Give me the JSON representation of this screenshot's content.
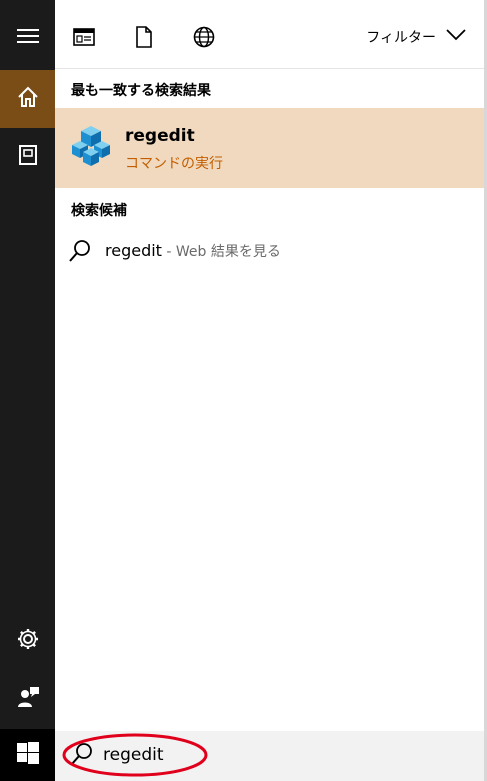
{
  "rail": {
    "items": [
      {
        "icon": "hamburger-menu-icon"
      },
      {
        "icon": "home-icon",
        "active": true
      },
      {
        "icon": "notebook-icon"
      },
      {
        "icon": "gear-icon"
      },
      {
        "icon": "feedback-person-icon"
      },
      {
        "icon": "windows-logo-icon"
      }
    ],
    "accent_color": "#7a4d17"
  },
  "topbar": {
    "icons": [
      "apps-view-icon",
      "document-icon",
      "globe-icon"
    ],
    "filter_label": "フィルター"
  },
  "best_match": {
    "section_label": "最も一致する検索結果",
    "title": "regedit",
    "subtitle": "コマンドの実行",
    "icon": "regedit-cubes-icon",
    "highlight_color": "#f0d9be",
    "subtitle_color": "#c25e00"
  },
  "suggestions": {
    "section_label": "検索候補",
    "items": [
      {
        "text": "regedit",
        "hint": " - Web 結果を見る",
        "icon": "search-icon"
      }
    ]
  },
  "search": {
    "value": "regedit",
    "annotation_color": "#e0001b"
  }
}
